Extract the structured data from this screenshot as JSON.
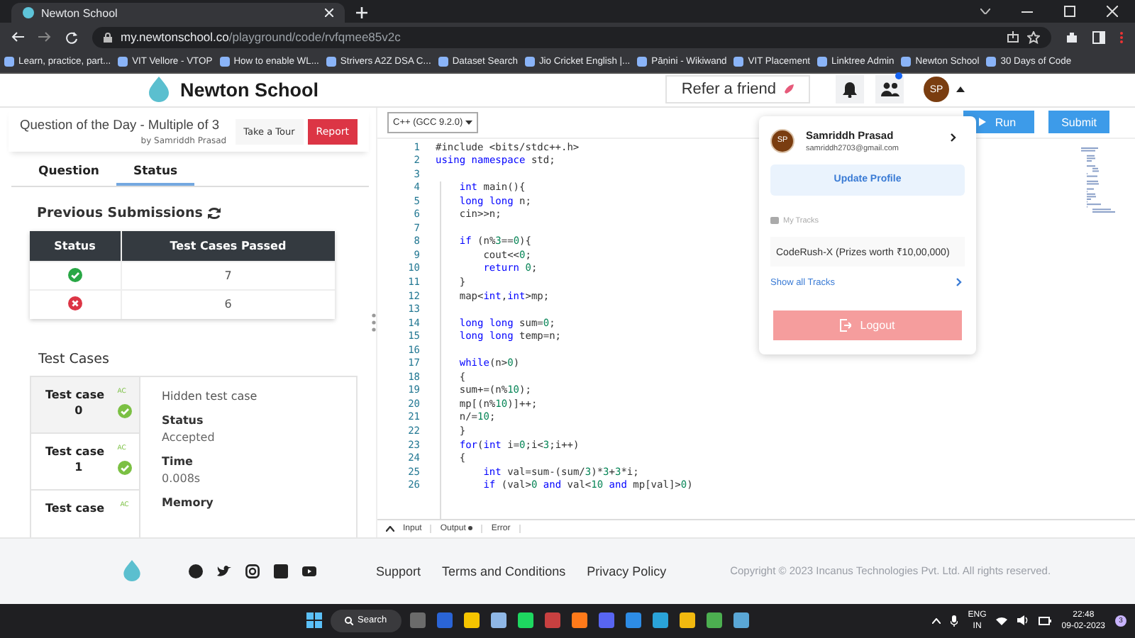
{
  "browser": {
    "tabs": [
      {
        "title": "Newton School",
        "selected": true
      }
    ],
    "url": {
      "domain": "my.newtonschool.co",
      "path": "/playground/code/rvfqmee85v2c"
    },
    "bookmarks": [
      "Learn, practice, part...",
      "VIT Vellore - VTOP",
      "How to enable WL...",
      "Strivers A2Z DSA C...",
      "Dataset Search",
      "Jio Cricket English |...",
      "Pāṇini - Wikiwand",
      "VIT Placement",
      "Linktree Admin",
      "Newton School",
      "30 Days of Code"
    ]
  },
  "site_header": {
    "logo_text": "Newton School",
    "refer_button": "Refer a friend",
    "avatar": "SP",
    "notification_dot": true
  },
  "problem": {
    "title": "Question of the Day - Multiple of 3",
    "author": "by Samriddh Prasad",
    "tour_button": "Take a Tour",
    "report_button": "Report"
  },
  "panel_tabs": [
    {
      "label": "Question",
      "selected": false
    },
    {
      "label": "Status",
      "selected": true
    }
  ],
  "submissions": {
    "title": "Previous Submissions",
    "columns": [
      "Status",
      "Test Cases Passed"
    ],
    "rows": [
      {
        "kind": "accepted",
        "passed": "7"
      },
      {
        "kind": "rejected",
        "passed": "6"
      }
    ]
  },
  "test_cases": {
    "title": "Test Cases",
    "items": [
      {
        "label": "Test case",
        "number": "0",
        "verdict": "AC",
        "selected": true
      },
      {
        "label": "Test case",
        "number": "1",
        "verdict": "AC",
        "selected": false
      },
      {
        "label": "Test case",
        "verdict": "AC",
        "selected": false
      }
    ],
    "detail": {
      "heading": "Hidden test case",
      "fields": [
        {
          "label": "Status",
          "value": "Accepted"
        },
        {
          "label": "Time",
          "value": "0.008s"
        },
        {
          "label": "Memory"
        }
      ]
    }
  },
  "editor": {
    "language": "C++ (GCC 9.2.0)",
    "run_button": "Run",
    "submit_button": "Submit",
    "lines": [
      {
        "number": "1",
        "code": "#include <bits/stdc++.h>"
      },
      {
        "number": "2",
        "code": "using namespace std;"
      },
      {
        "number": "3"
      },
      {
        "number": "4",
        "code": "    int main(){"
      },
      {
        "number": "5",
        "code": "    long long n;"
      },
      {
        "number": "6",
        "code": "    cin>>n;"
      },
      {
        "number": "7"
      },
      {
        "number": "8",
        "code": "    if (n%3==0){"
      },
      {
        "number": "9",
        "code": "        cout<<0;"
      },
      {
        "number": "10",
        "code": "        return 0;"
      },
      {
        "number": "11",
        "code": "    }"
      },
      {
        "number": "12",
        "code": "    map<int,int>mp;"
      },
      {
        "number": "13"
      },
      {
        "number": "14",
        "code": "    long long sum=0;"
      },
      {
        "number": "15",
        "code": "    long long temp=n;"
      },
      {
        "number": "16"
      },
      {
        "number": "17",
        "code": "    while(n>0)"
      },
      {
        "number": "18",
        "code": "    {"
      },
      {
        "number": "19",
        "code": "    sum+=(n%10);"
      },
      {
        "number": "20",
        "code": "    mp[(n%10)]++;"
      },
      {
        "number": "21",
        "code": "    n/=10;"
      },
      {
        "number": "22",
        "code": "    }"
      },
      {
        "number": "23",
        "code": "    for(int i=0;i<3;i++)"
      },
      {
        "number": "24",
        "code": "    {"
      },
      {
        "number": "25",
        "code": "        int val=sum-(sum/3)*3+3*i;"
      },
      {
        "number": "26",
        "code": "        if (val>0 and val<10 and mp[val]>0)"
      }
    ],
    "io_tabs": [
      {
        "label": "Input",
        "dot": false
      },
      {
        "label": "Output",
        "dot": true
      },
      {
        "label": "Error",
        "dot": false
      }
    ]
  },
  "account_menu": {
    "avatar": "SP",
    "name": "Samriddh Prasad",
    "email": "samriddh2703@gmail.com",
    "update_button": "Update Profile",
    "section_label": "My Tracks",
    "track": "CodeRush-X (Prizes worth ₹10,00,000)",
    "show_all": "Show all Tracks",
    "logout_button": "Logout"
  },
  "footer": {
    "links": [
      "Support",
      "Terms and Conditions",
      "Privacy Policy"
    ],
    "copyright": "Copyright © 2023 Incanus Technologies Pvt. Ltd. All rights reserved."
  },
  "taskbar": {
    "search": "Search",
    "language": "ENG",
    "region": "IN",
    "time": "22:48",
    "date": "09-02-2023",
    "notification_count": "3"
  }
}
